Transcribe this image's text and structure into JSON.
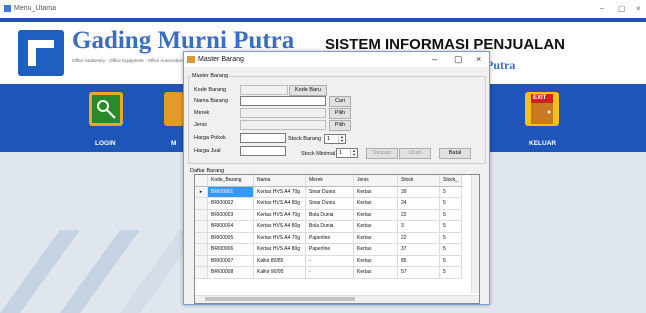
{
  "window": {
    "title": "Menu_Utama",
    "minimize": "–",
    "restore": "▢",
    "close": "×"
  },
  "header": {
    "company": "Gading Murni Putra",
    "company_sub": "Office Stationery - Office Equipment - Office Automation",
    "system_title": "SISTEM INFORMASI PENJUALAN",
    "company_suffix": "Putra"
  },
  "menu": {
    "login_label": "LOGIN",
    "m_label": "M",
    "keluar_label": "KELUAR",
    "exit_sign": "EXIT"
  },
  "dialog": {
    "title": "Master Barang",
    "minimize": "–",
    "restore": "▢",
    "close": "×",
    "group_master": "Master Barang",
    "kode_label": "Kode Barang",
    "kode_baru_button": "Kode Baru",
    "nama_label": "Nama Barang",
    "cari_button": "Cari",
    "merek_label": "Merek",
    "pilih_merek_button": "Pilih",
    "jenis_label": "Jenis",
    "pilih_jenis_button": "Pilih",
    "harga_pokok_label": "Harga Pokok",
    "harga_jual_label": "Harga Jual",
    "stock_barang_label": "Stock Barang",
    "stock_barang_value": "1",
    "stock_minimal_label": "Stock Minimal",
    "stock_minimal_value": "1",
    "simpan_button": "Simpan",
    "ubah_button": "Ubah",
    "batal_button": "Batal",
    "group_daftar": "Daftar Barang",
    "columns": [
      "Kode_Barang",
      "Nama",
      "Merek",
      "Jenis",
      "Stock",
      "Stock_"
    ],
    "rows": [
      [
        "BRI00001",
        "Kertas HVS A4 70g",
        "Sinar Dunia",
        "Kertas",
        "39",
        "5"
      ],
      [
        "BRI00002",
        "Kertas HVS A4 80g",
        "Sinar Dunia",
        "Kertas",
        "24",
        "5"
      ],
      [
        "BRI00003",
        "Kertas HVS A4 70g",
        "Bola Dunia",
        "Kertas",
        "22",
        "5"
      ],
      [
        "BRI00004",
        "Kertas HVS A4 80g",
        "Bola Dunia",
        "Kertas",
        "3",
        "5"
      ],
      [
        "BRI00005",
        "Kertas HVS A4 70g",
        "Paperline",
        "Kertas",
        "22",
        "5"
      ],
      [
        "BRI00006",
        "Kertas HVS A4 80g",
        "Paperline",
        "Kertas",
        "37",
        "5"
      ],
      [
        "BRI00007",
        "Kalkir 80/85",
        "-",
        "Kertas",
        "85",
        "5"
      ],
      [
        "BRI00008",
        "Kalkir 90/95",
        "-",
        "Kertas",
        "57",
        "5"
      ]
    ]
  }
}
